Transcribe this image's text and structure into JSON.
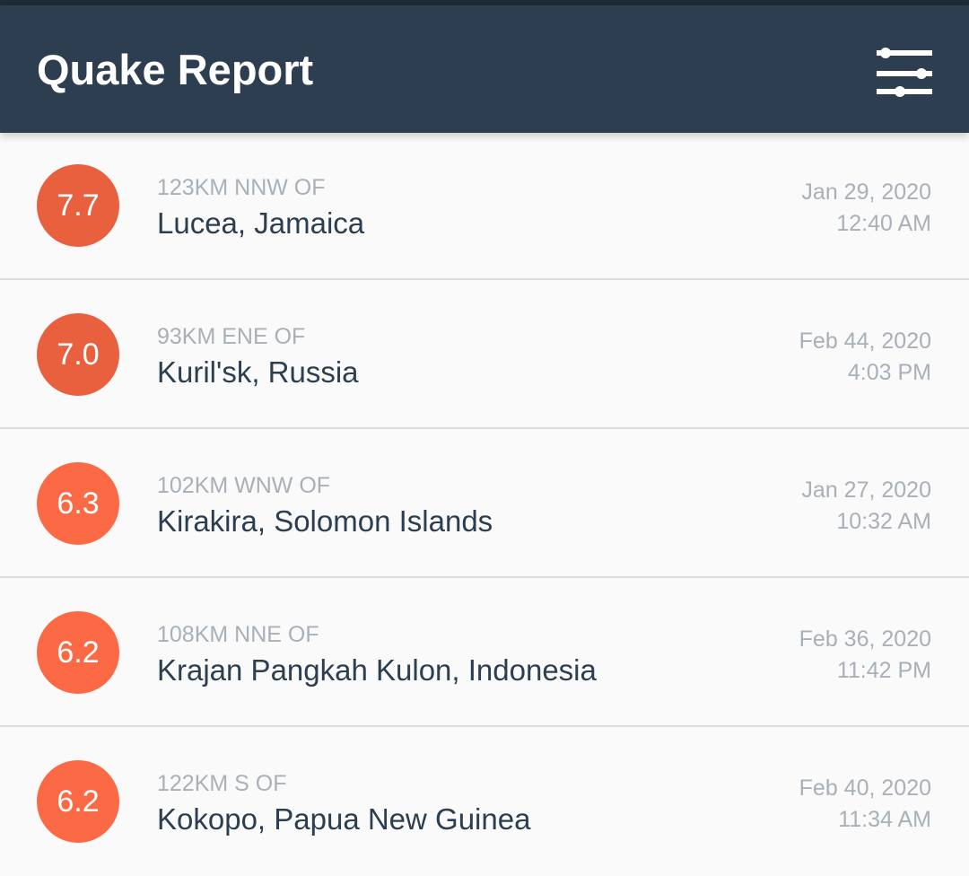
{
  "app_bar": {
    "title": "Quake Report",
    "filter_icon": "tune-sliders-icon",
    "background_color": "#2c3e50"
  },
  "earthquakes": [
    {
      "magnitude": "7.7",
      "offset": "123KM NNW OF",
      "place": "Lucea, Jamaica",
      "date": "Jan 29, 2020",
      "time": "12:40 AM",
      "color": "#e8603e"
    },
    {
      "magnitude": "7.0",
      "offset": "93KM ENE OF",
      "place": "Kuril'sk, Russia",
      "date": "Feb 44, 2020",
      "time": "4:03 PM",
      "color": "#e8603e"
    },
    {
      "magnitude": "6.3",
      "offset": "102KM WNW OF",
      "place": "Kirakira, Solomon Islands",
      "date": "Jan 27, 2020",
      "time": "10:32 AM",
      "color": "#fc6a45"
    },
    {
      "magnitude": "6.2",
      "offset": "108KM NNE OF",
      "place": "Krajan Pangkah Kulon, Indonesia",
      "date": "Feb 36, 2020",
      "time": "11:42 PM",
      "color": "#fc6a45"
    },
    {
      "magnitude": "6.2",
      "offset": "122KM S OF",
      "place": "Kokopo, Papua New Guinea",
      "date": "Feb 40, 2020",
      "time": "11:34 AM",
      "color": "#fc6a45"
    }
  ]
}
